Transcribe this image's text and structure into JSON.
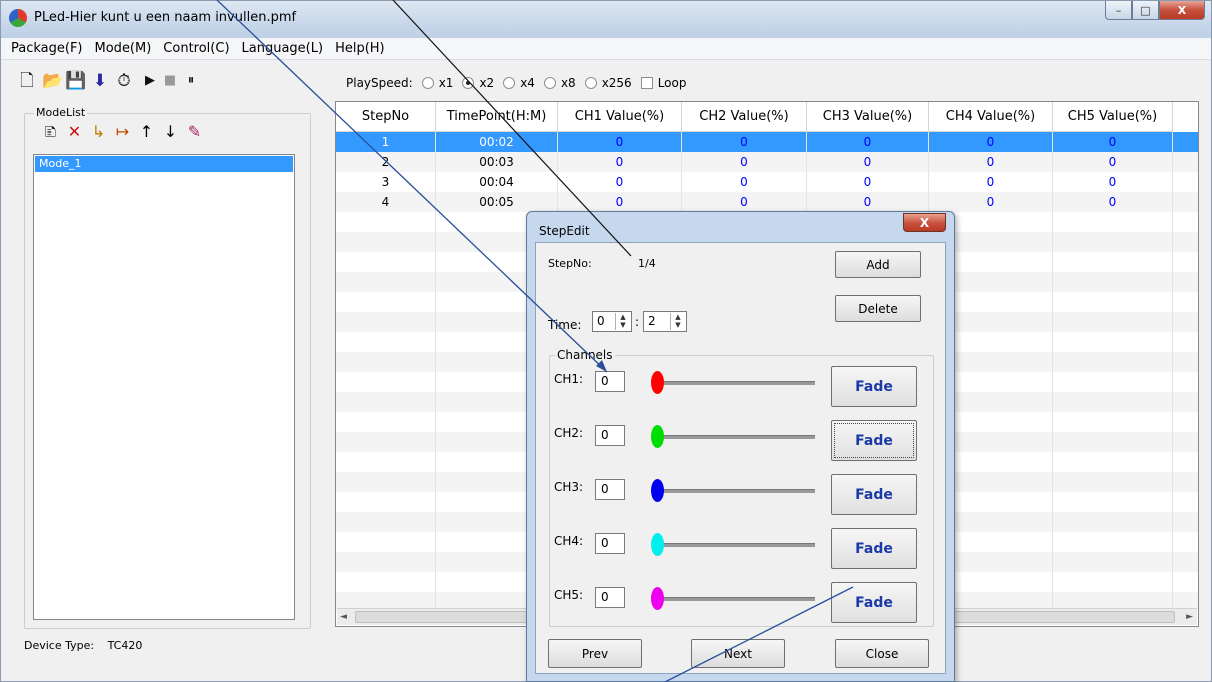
{
  "window": {
    "title": "PLed-Hier kunt u een naam invullen.pmf",
    "min": "–",
    "max": "□",
    "close": "X"
  },
  "menu": [
    "Package(F)",
    "Mode(M)",
    "Control(C)",
    "Language(L)",
    "Help(H)"
  ],
  "toolbar": {
    "icons": [
      "new-icon",
      "open-folder-icon",
      "save-icon",
      "download-icon",
      "clock-icon",
      "play-icon",
      "stop-icon",
      "pause-icon"
    ],
    "glyphs": [
      "🗋",
      "📂",
      "💾",
      "⬇",
      "⏱",
      "▶",
      "■",
      "⏸"
    ]
  },
  "playspeed": {
    "label": "PlaySpeed:",
    "options": [
      "x1",
      "x2",
      "x4",
      "x8",
      "x256"
    ],
    "selected": "x2",
    "loop_label": "Loop",
    "loop_checked": false
  },
  "modelist": {
    "title": "ModeList",
    "icons": [
      "new-mode-icon",
      "delete-mode-icon",
      "import-mode-icon",
      "export-mode-icon",
      "move-up-icon",
      "move-down-icon",
      "edit-mode-icon"
    ],
    "glyphs": [
      "🗈",
      "✕",
      "↳",
      "↦",
      "↑",
      "↓",
      "✎"
    ],
    "items": [
      "Mode_1"
    ]
  },
  "device": {
    "label": "Device Type:",
    "value": "TC420"
  },
  "grid": {
    "headers": [
      "StepNo",
      "TimePoint(H:M)",
      "CH1 Value(%)",
      "CH2 Value(%)",
      "CH3 Value(%)",
      "CH4 Value(%)",
      "CH5 Value(%)"
    ],
    "rows": [
      [
        "1",
        "00:02",
        "0",
        "0",
        "0",
        "0",
        "0"
      ],
      [
        "2",
        "00:03",
        "0",
        "0",
        "0",
        "0",
        "0"
      ],
      [
        "3",
        "00:04",
        "0",
        "0",
        "0",
        "0",
        "0"
      ],
      [
        "4",
        "00:05",
        "0",
        "0",
        "0",
        "0",
        "0"
      ]
    ],
    "selected_row": 0
  },
  "dialog": {
    "title": "StepEdit",
    "close": "X",
    "stepno_label": "StepNo:",
    "stepno_value": "1/4",
    "add": "Add",
    "delete": "Delete",
    "time_label": "Time:",
    "time_hour": "0",
    "time_sep": ":",
    "time_min": "2",
    "channels_title": "Channels",
    "channels": [
      {
        "label": "CH1:",
        "value": "0",
        "color": "#ff0000",
        "fade": "Fade",
        "level": 0
      },
      {
        "label": "CH2:",
        "value": "0",
        "color": "#00dd00",
        "fade": "Fade",
        "level": 0
      },
      {
        "label": "CH3:",
        "value": "0",
        "color": "#0000ee",
        "fade": "Fade",
        "level": 0
      },
      {
        "label": "CH4:",
        "value": "0",
        "color": "#00eeee",
        "fade": "Fade",
        "level": 0
      },
      {
        "label": "CH5:",
        "value": "0",
        "color": "#ee00ee",
        "fade": "Fade",
        "level": 0
      }
    ],
    "prev": "Prev",
    "next": "Next",
    "close_btn": "Close"
  },
  "colors": {
    "selection": "#3399ff",
    "value_text": "#0000ff",
    "fade_text": "#1a3aa8"
  }
}
